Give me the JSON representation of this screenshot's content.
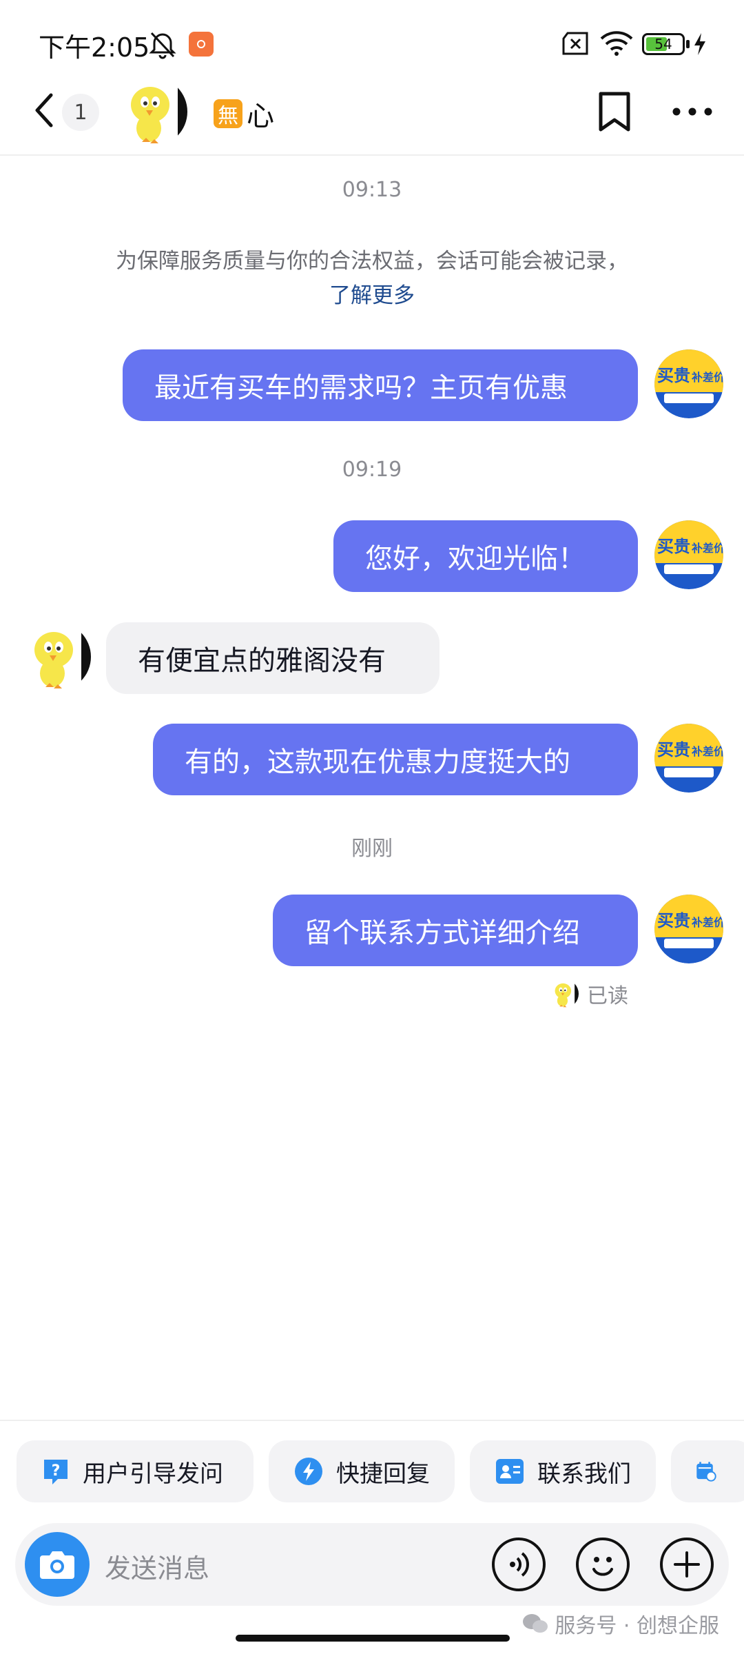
{
  "status_bar": {
    "time": "下午2:05",
    "battery": "54",
    "icons": [
      "mute-icon",
      "app-notification-icon",
      "sim-off-icon",
      "wifi-icon",
      "battery-icon",
      "charging-icon"
    ]
  },
  "header": {
    "unread_count": "1",
    "name_badge": "無",
    "name": "心",
    "icons": [
      "back-icon",
      "bookmark-icon",
      "more-icon"
    ]
  },
  "chat": {
    "timestamp_1": "09:13",
    "notice_text": "为保障服务质量与你的合法权益，会话可能会被记录，",
    "notice_link": "了解更多",
    "msg_1": "最近有买车的需求吗？主页有优惠",
    "timestamp_2": "09:19",
    "msg_2": "您好，欢迎光临！",
    "msg_3": "有便宜点的雅阁没有",
    "msg_4": "有的，这款现在优惠力度挺大的",
    "timestamp_3": "刚刚",
    "msg_5": "留个联系方式详细介绍",
    "read_status": "已读"
  },
  "shop_avatar": {
    "line1": "买贵",
    "line2": "补差价"
  },
  "quick_actions": [
    {
      "label": "用户引导发问",
      "icon": "question-icon"
    },
    {
      "label": "快捷回复",
      "icon": "lightning-icon"
    },
    {
      "label": "联系我们",
      "icon": "contact-card-icon"
    },
    {
      "label": "",
      "icon": "calendar-icon"
    }
  ],
  "input": {
    "placeholder": "发送消息",
    "icons": [
      "camera-icon",
      "voice-icon",
      "emoji-icon",
      "plus-icon"
    ]
  },
  "watermark": "服务号 · 创想企服",
  "colors": {
    "outgoing_bubble": "#6674f1",
    "incoming_bubble": "#f1f1f3",
    "accent_blue": "#2e8ff0"
  }
}
